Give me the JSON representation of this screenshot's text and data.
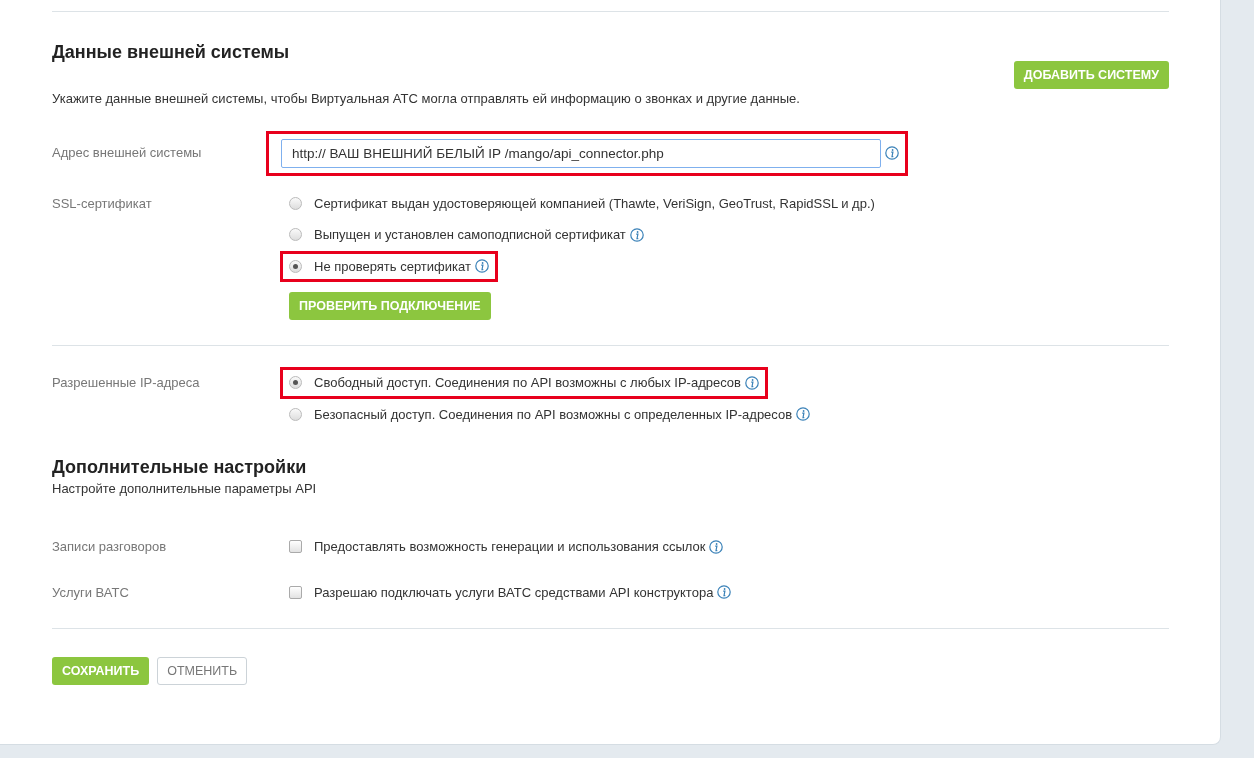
{
  "external_system": {
    "title": "Данные внешней системы",
    "add_button": "ДОБАВИТЬ СИСТЕМУ",
    "description": "Укажите данные внешней системы, чтобы Виртуальная АТС могла отправлять ей информацию о звонках и другие данные.",
    "address": {
      "label": "Адрес внешней системы",
      "value": "http:// ВАШ ВНЕШНИЙ БЕЛЫЙ IP /mango/api_connector.php",
      "info": true,
      "highlighted": true
    },
    "ssl": {
      "label": "SSL-сертификат",
      "options": [
        {
          "label": "Сертификат выдан удостоверяющей компанией (Thawte, VeriSign, GeoTrust, RapidSSL и др.)",
          "selected": false,
          "info": false,
          "highlighted": false
        },
        {
          "label": "Выпущен и установлен самоподписной сертификат",
          "selected": false,
          "info": true,
          "highlighted": false
        },
        {
          "label": "Не проверять сертификат",
          "selected": true,
          "info": true,
          "highlighted": true
        }
      ]
    },
    "check_button": "ПРОВЕРИТЬ ПОДКЛЮЧЕНИЕ",
    "allowed_ips": {
      "label": "Разрешенные IP-адреса",
      "options": [
        {
          "label": "Свободный доступ. Соединения по API возможны с любых IP-адресов",
          "selected": true,
          "info": true,
          "highlighted": true
        },
        {
          "label": "Безопасный доступ. Соединения по API возможны с определенных IP-адресов",
          "selected": false,
          "info": true,
          "highlighted": false
        }
      ]
    }
  },
  "additional": {
    "title": "Дополнительные настройки",
    "description": "Настройте дополнительные параметры API",
    "settings": [
      {
        "label": "Записи разговоров",
        "option": "Предоставлять возможность генерации и использования ссылок",
        "checked": false,
        "info": true
      },
      {
        "label": "Услуги ВАТС",
        "option": "Разрешаю подключать услуги ВАТС средствами API конструктора",
        "checked": false,
        "info": true
      }
    ]
  },
  "footer": {
    "save_button": "СОХРАНИТЬ",
    "cancel_button": "ОТМЕНИТЬ"
  }
}
